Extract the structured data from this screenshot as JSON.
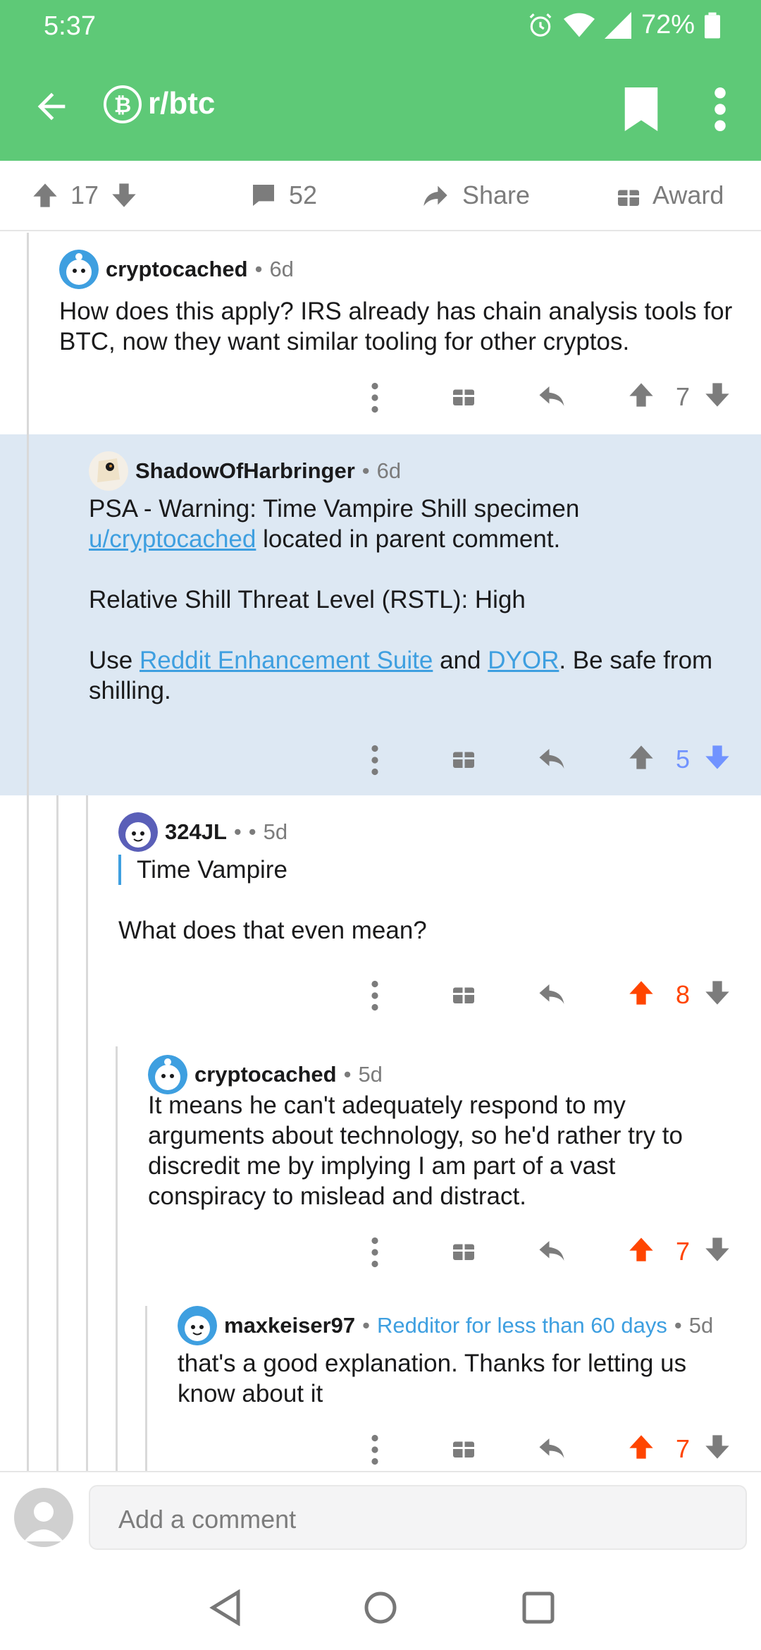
{
  "status_bar": {
    "time": "5:37",
    "battery": "72%"
  },
  "app_bar": {
    "title": "r/btc",
    "subreddit_icon": "bitcoin-icon"
  },
  "post_actions": {
    "score": "17",
    "comments": "52",
    "share": "Share",
    "award": "Award"
  },
  "comments": [
    {
      "user": "cryptocached",
      "flair": "",
      "age": "6d",
      "score": "7",
      "vote": "none",
      "body": [
        "How does this apply? IRS already has chain analysis tools for BTC, now they want similar tooling for other cryptos."
      ]
    },
    {
      "user": "ShadowOfHarbringer",
      "age": "6d",
      "score": "5",
      "vote": "down",
      "body_p1_pre": "PSA - Warning: Time Vampire Shill specimen ",
      "body_p1_link": "u/cryptocached",
      "body_p1_post": " located in parent comment.",
      "body_p2": "Relative Shill Threat Level (RSTL): High",
      "body_p3_pre": "Use ",
      "body_p3_link1": "Reddit Enhancement Suite",
      "body_p3_mid": " and ",
      "body_p3_link2": "DYOR",
      "body_p3_post": ". Be safe from shilling."
    },
    {
      "user": "324JL",
      "user_flair_dots": "•",
      "age": "5d",
      "score": "8",
      "vote": "up",
      "quote": "Time Vampire",
      "body": "What does that even mean?"
    },
    {
      "user": "cryptocached",
      "age": "5d",
      "score": "7",
      "vote": "up",
      "body": "It means he can't adequately respond to my arguments about technology, so he'd rather try to discredit me by implying I am part of a vast conspiracy to mislead and distract."
    },
    {
      "user": "maxkeiser97",
      "flair": "Redditor for less than 60 days",
      "age": "5d",
      "score": "7",
      "vote": "up",
      "body": "that's a good explanation. Thanks for letting us know about it"
    }
  ],
  "compose": {
    "placeholder": "Add a comment"
  },
  "colors": {
    "header_green": "#5ec977",
    "upvote": "#ff4500",
    "downvote": "#7193ff",
    "highlight": "#dde8f3",
    "link": "#3e9fe0"
  }
}
